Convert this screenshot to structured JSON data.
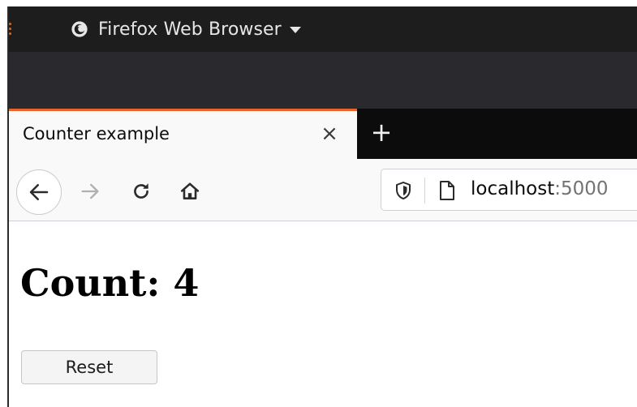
{
  "system_bar": {
    "app_name": "Firefox Web Browser"
  },
  "browser": {
    "tabs": [
      {
        "title": "Counter example",
        "active": true
      }
    ],
    "close_tab_glyph": "×",
    "new_tab_glyph": "+",
    "url": {
      "host": "localhost",
      "port": ":5000"
    }
  },
  "page": {
    "heading": "Count: 4",
    "reset_button_label": "Reset"
  },
  "icons": {
    "firefox": "firefox-icon",
    "back": "arrow-left-icon",
    "forward": "arrow-right-icon",
    "reload": "reload-icon",
    "home": "home-icon",
    "shield": "shield-icon",
    "page": "page-icon"
  },
  "colors": {
    "tab_accent": "#e8642c",
    "system_bar": "#1d1d1d",
    "titlebar": "#2a2a2e",
    "tabstrip": "#0c0c0d",
    "toolbar": "#f9f9fa"
  }
}
